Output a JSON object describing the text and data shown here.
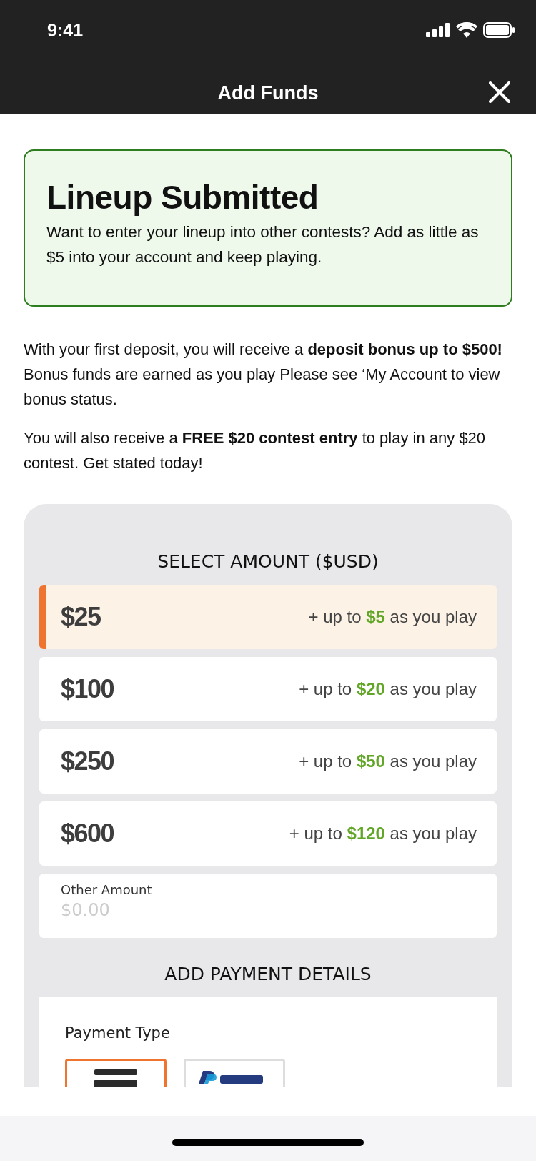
{
  "status_bar": {
    "time": "9:41"
  },
  "header": {
    "title": "Add Funds"
  },
  "banner": {
    "title": "Lineup Submitted",
    "text": "Want to enter your lineup into other contests? Add as little as $5 into your account and keep playing."
  },
  "paragraphs": [
    "With your first deposit, you will receive a **deposit bonus up to $500!** Bonus funds are earned as you play Please see ‘My Account to view bonus status.",
    "You will also receive a **FREE $20 contest entry** to play in any $20 contest. Get stated today!"
  ],
  "amount_section": {
    "title": "SELECT AMOUNT ($USD)",
    "options": [
      {
        "amount": "$25",
        "prefix": "+ up to",
        "bonus": "$5",
        "suffix": "as you play",
        "selected": true
      },
      {
        "amount": "$100",
        "prefix": "+ up to",
        "bonus": "$20",
        "suffix": "as you play",
        "selected": false
      },
      {
        "amount": "$250",
        "prefix": "+ up to",
        "bonus": "$50",
        "suffix": "as you play",
        "selected": false
      },
      {
        "amount": "$600",
        "prefix": "+ up to",
        "bonus": "$120",
        "suffix": "as you play",
        "selected": false
      }
    ],
    "other": {
      "label": "Other Amount",
      "placeholder": "$0.00"
    }
  },
  "payment_section": {
    "title": "ADD PAYMENT DETAILS",
    "label": "Payment Type",
    "types": [
      {
        "kind": "card",
        "selected": true
      },
      {
        "kind": "paypal",
        "selected": false
      }
    ]
  }
}
